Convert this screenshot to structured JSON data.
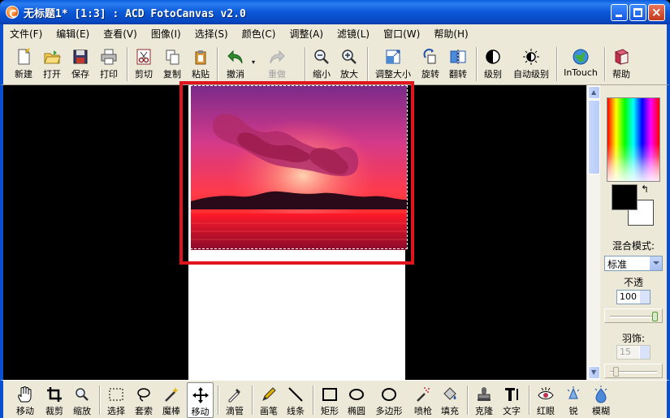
{
  "window": {
    "title": "无标题1* [1:3] : ACD FotoCanvas v2.0",
    "close_glyph": "×",
    "accent": "#0a4fd0"
  },
  "menu": [
    "文件(F)",
    "编辑(E)",
    "查看(V)",
    "图像(I)",
    "选择(S)",
    "颜色(C)",
    "调整(A)",
    "滤镜(L)",
    "窗口(W)",
    "帮助(H)"
  ],
  "toolbar": {
    "new": "新建",
    "open": "打开",
    "save": "保存",
    "print": "打印",
    "cut": "剪切",
    "copy": "复制",
    "paste": "粘贴",
    "undo": "撤消",
    "redo": "重做",
    "zoom_out": "缩小",
    "zoom_in": "放大",
    "resize": "调整大小",
    "rotate": "旋转",
    "flip": "翻转",
    "levels": "级别",
    "auto_levels": "自动级别",
    "intouch": "InTouch",
    "help": "帮助"
  },
  "panel": {
    "blend_label": "混合模式:",
    "blend_value": "标准",
    "opacity_label": "不透",
    "opacity_value": "100",
    "feather_label": "羽饰:",
    "feather_value": "15",
    "swap_glyph": "↰",
    "foreground_color": "#000000",
    "background_color": "#ffffff"
  },
  "scroll": {
    "up_glyph": "▲",
    "down_glyph": "▼"
  },
  "tools": {
    "move_hand": "移动",
    "crop": "裁剪",
    "zoom": "缩放",
    "select": "选择",
    "lasso": "套索",
    "magic_wand": "魔棒",
    "move": "移动",
    "dropper": "滴管",
    "pen": "画笔",
    "line": "线条",
    "rect": "矩形",
    "ellipse": "椭圆",
    "polygon": "多边形",
    "spray": "喷枪",
    "fill": "填充",
    "clone": "克隆",
    "text": "文字",
    "redeye": "红眼",
    "sharpen": "锐",
    "blur": "模糊"
  },
  "highlight_color": "#e0141c"
}
